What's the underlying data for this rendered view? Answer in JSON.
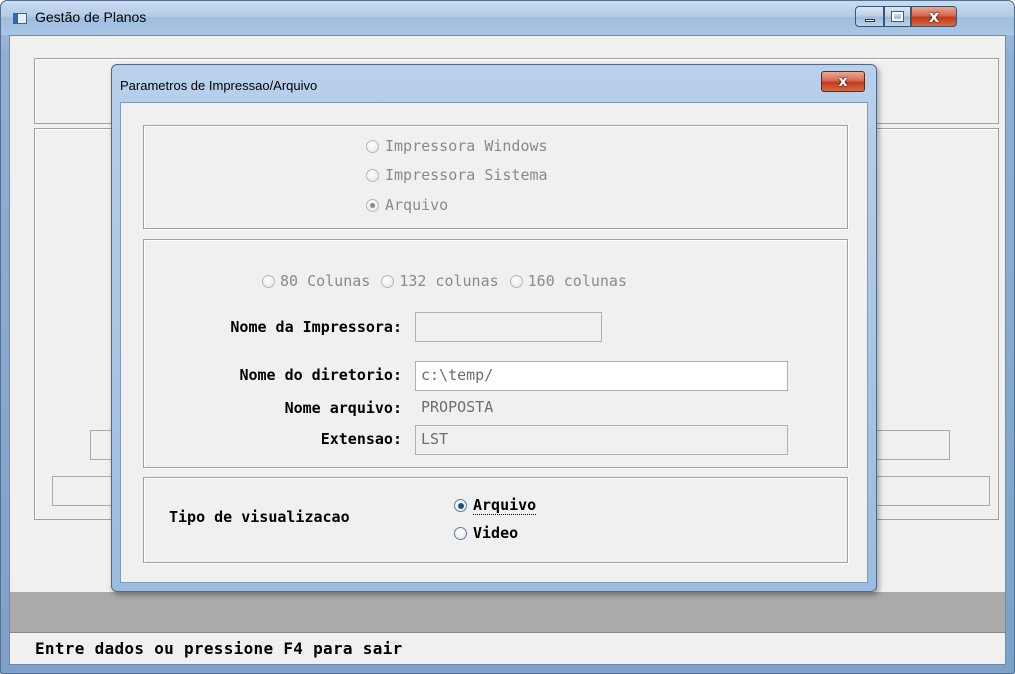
{
  "main_window": {
    "title": "Gestão de Planos",
    "status_text": "Entre dados ou pressione F4 para sair"
  },
  "dialog": {
    "title": "Parametros de Impressao/Arquivo",
    "close_glyph": "x",
    "output_options": [
      {
        "label": "Impressora Windows",
        "checked": false,
        "enabled": false
      },
      {
        "label": "Impressora Sistema",
        "checked": false,
        "enabled": false
      },
      {
        "label": "Arquivo",
        "checked": true,
        "enabled": false
      }
    ],
    "column_options": [
      {
        "label": "80 Colunas",
        "checked": false,
        "enabled": false
      },
      {
        "label": "132 colunas",
        "checked": false,
        "enabled": false
      },
      {
        "label": "160 colunas",
        "checked": false,
        "enabled": false
      }
    ],
    "printer_name": {
      "label": "Nome da Impressora:",
      "value": ""
    },
    "directory": {
      "label": "Nome do diretorio:",
      "value": "c:\\temp/"
    },
    "file_name": {
      "label": "Nome arquivo:",
      "value": "PROPOSTA"
    },
    "extension": {
      "label": "Extensao:",
      "value": "LST"
    },
    "view_type": {
      "label": "Tipo de visualizacao",
      "options": [
        {
          "label": "Arquivo",
          "checked": true,
          "enabled": true
        },
        {
          "label": "Video",
          "checked": false,
          "enabled": true
        }
      ]
    }
  },
  "colors": {
    "title_bar": "#b3cbe6",
    "close_button": "#c2391c",
    "client_bg": "#f0f0f0",
    "gray_band": "#aaaaaa",
    "disabled_text": "#8a8a8a"
  },
  "icons": {
    "app": "window-app-icon",
    "minimize": "minimize-icon",
    "maximize": "maximize-icon",
    "close": "close-icon"
  }
}
